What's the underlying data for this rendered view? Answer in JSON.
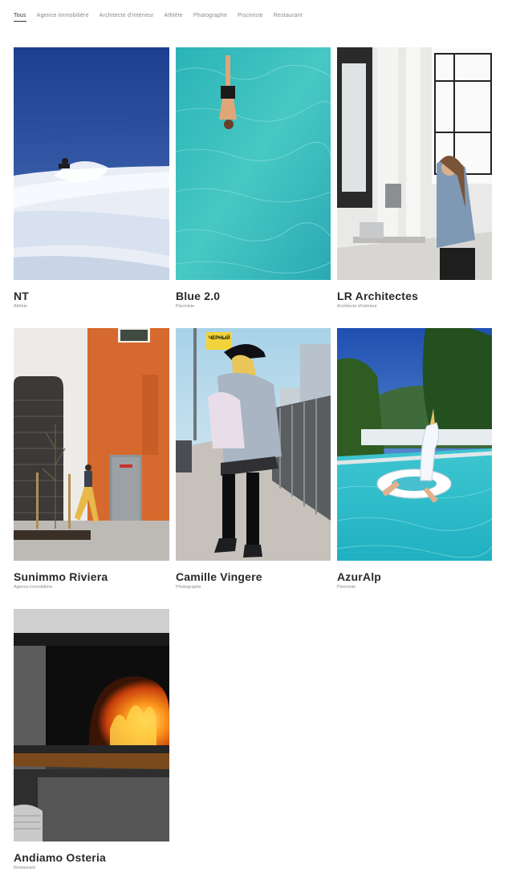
{
  "filters": [
    {
      "label": "Tous",
      "active": true
    },
    {
      "label": "Agence immobilière"
    },
    {
      "label": "Architecte d'intérieur"
    },
    {
      "label": "Athlète"
    },
    {
      "label": "Photographe"
    },
    {
      "label": "Pisciniste"
    },
    {
      "label": "Restaurant"
    }
  ],
  "projects": [
    {
      "title": "NT",
      "category": "Athlète"
    },
    {
      "title": "Blue 2.0",
      "category": "Pisciniste"
    },
    {
      "title": "LR Architectes",
      "category": "Architecte d'intérieur"
    },
    {
      "title": "Sunimmo Riviera",
      "category": "Agence immobilière"
    },
    {
      "title": "Camille Vingere",
      "category": "Photographe"
    },
    {
      "title": "AzurAlp",
      "category": "Pisciniste"
    },
    {
      "title": "Andiamo Osteria",
      "category": "Restaurant"
    }
  ],
  "photo_text": {
    "street_sign": "ЧЕРНЫЙ"
  }
}
